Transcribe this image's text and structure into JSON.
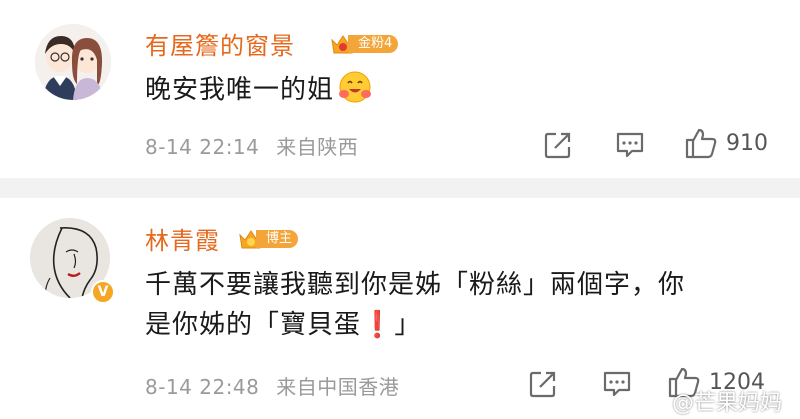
{
  "comments": [
    {
      "username": "有屋簷的窗景",
      "badge": "金粉4",
      "content": "晚安我唯一的姐",
      "content_emoji": "hugging-face-emoji",
      "date": "8-14 22:14",
      "location": "来自陕西",
      "likes": "910"
    },
    {
      "username": "林青霞",
      "badge": "博主",
      "verified": true,
      "content_line1": "千萬不要讓我聽到你是姊「粉絲」兩個字，你",
      "content_line2_pre": "是你姊的「寶貝蛋",
      "content_line2_excl": "❗",
      "content_line2_post": "」",
      "date": "8-14 22:48",
      "location": "来自中国香港",
      "likes": "1204"
    }
  ],
  "watermark": "@芒果妈妈",
  "colors": {
    "username": "#e5681c",
    "badge": "#f3a53a",
    "meta": "#9a9a9a",
    "separator": "#f2f2f2"
  }
}
